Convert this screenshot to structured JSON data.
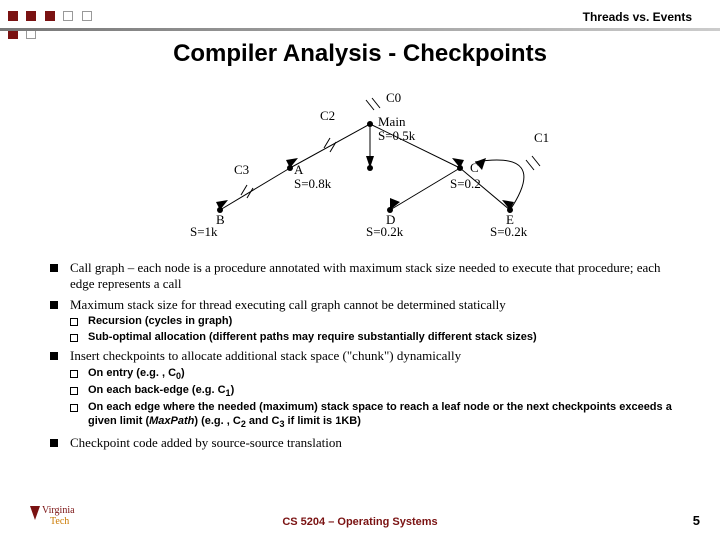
{
  "header": {
    "label": "Threads vs. Events"
  },
  "title": "Compiler Analysis - Checkpoints",
  "diagram": {
    "nodes": {
      "C0": "C0",
      "C1": "C1",
      "C2": "C2",
      "C3": "C3",
      "Main": "Main",
      "S05k": "S=0.5k",
      "A": "A",
      "S08k": "S=0.8k",
      "B": "B",
      "S1k": "S=1k",
      "D": "D",
      "S02kD": "S=0.2k",
      "E": "E",
      "S02kE": "S=0.2k",
      "C": "C",
      "S02": "S=0.2"
    }
  },
  "bullets": [
    "Call graph – each node is a procedure annotated with maximum stack size needed to execute that procedure; each edge represents a call",
    "Maximum stack size for thread executing call graph cannot be determined statically",
    "Insert checkpoints to allocate additional stack space (\"chunk\") dynamically",
    "Checkpoint code added by source-source translation"
  ],
  "sub1": [
    "Recursion (cycles in graph)",
    "Sub-optimal allocation (different paths may require substantially different stack sizes)"
  ],
  "sub2_parts": {
    "a_pre": "On entry (e.g. , C",
    "a_sub": "0",
    "a_post": ")",
    "b_pre": "On each back-edge (e.g. C",
    "b_sub": "1",
    "b_post": ")",
    "c_pre": "On each edge where the needed (maximum) stack space to reach a leaf node or the next checkpoints exceeds a given limit (",
    "c_it": "MaxPath",
    "c_mid": ") (e.g. , C",
    "c_sub1": "2",
    "c_mid2": " and C",
    "c_sub2": "3",
    "c_post": " if limit is 1KB)"
  },
  "footer": "CS 5204 – Operating Systems",
  "pagenum": "5",
  "logo": {
    "line1": "Virginia",
    "line2": "Tech"
  }
}
